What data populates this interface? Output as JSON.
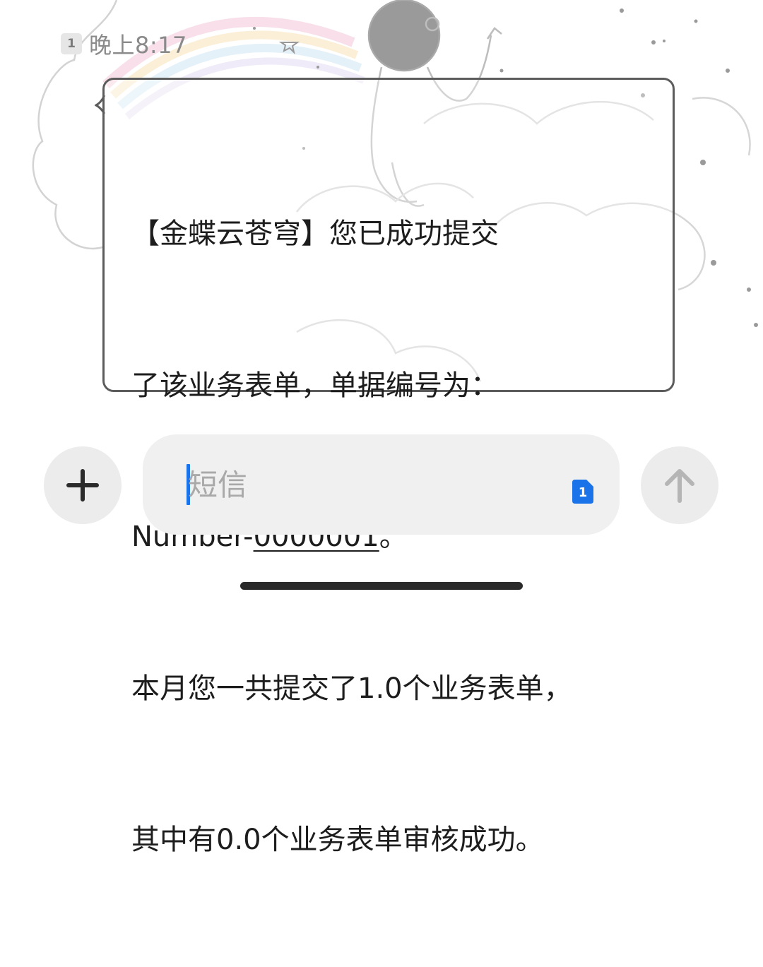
{
  "message": {
    "sim_label": "1",
    "time": "晚上8:17",
    "lines": [
      "【金蝶云苍穹】您已成功提交",
      "了该业务表单，单据编号为：",
      "本月您一共提交了1.0个业务表单，",
      "其中有0.0个业务表单审核成功。"
    ],
    "number_prefix": "Number-",
    "number_link": "0000001",
    "number_suffix": "。"
  },
  "composer": {
    "add_icon": "plus-icon",
    "placeholder": "短信",
    "sim_label": "1",
    "sim_color": "#1a73e8",
    "send_icon": "arrow-up-icon"
  },
  "colors": {
    "accent": "#1a73e8",
    "bubble_border": "#5c5c5c",
    "input_bg": "#f0f0f0",
    "button_bg": "#ececec"
  }
}
